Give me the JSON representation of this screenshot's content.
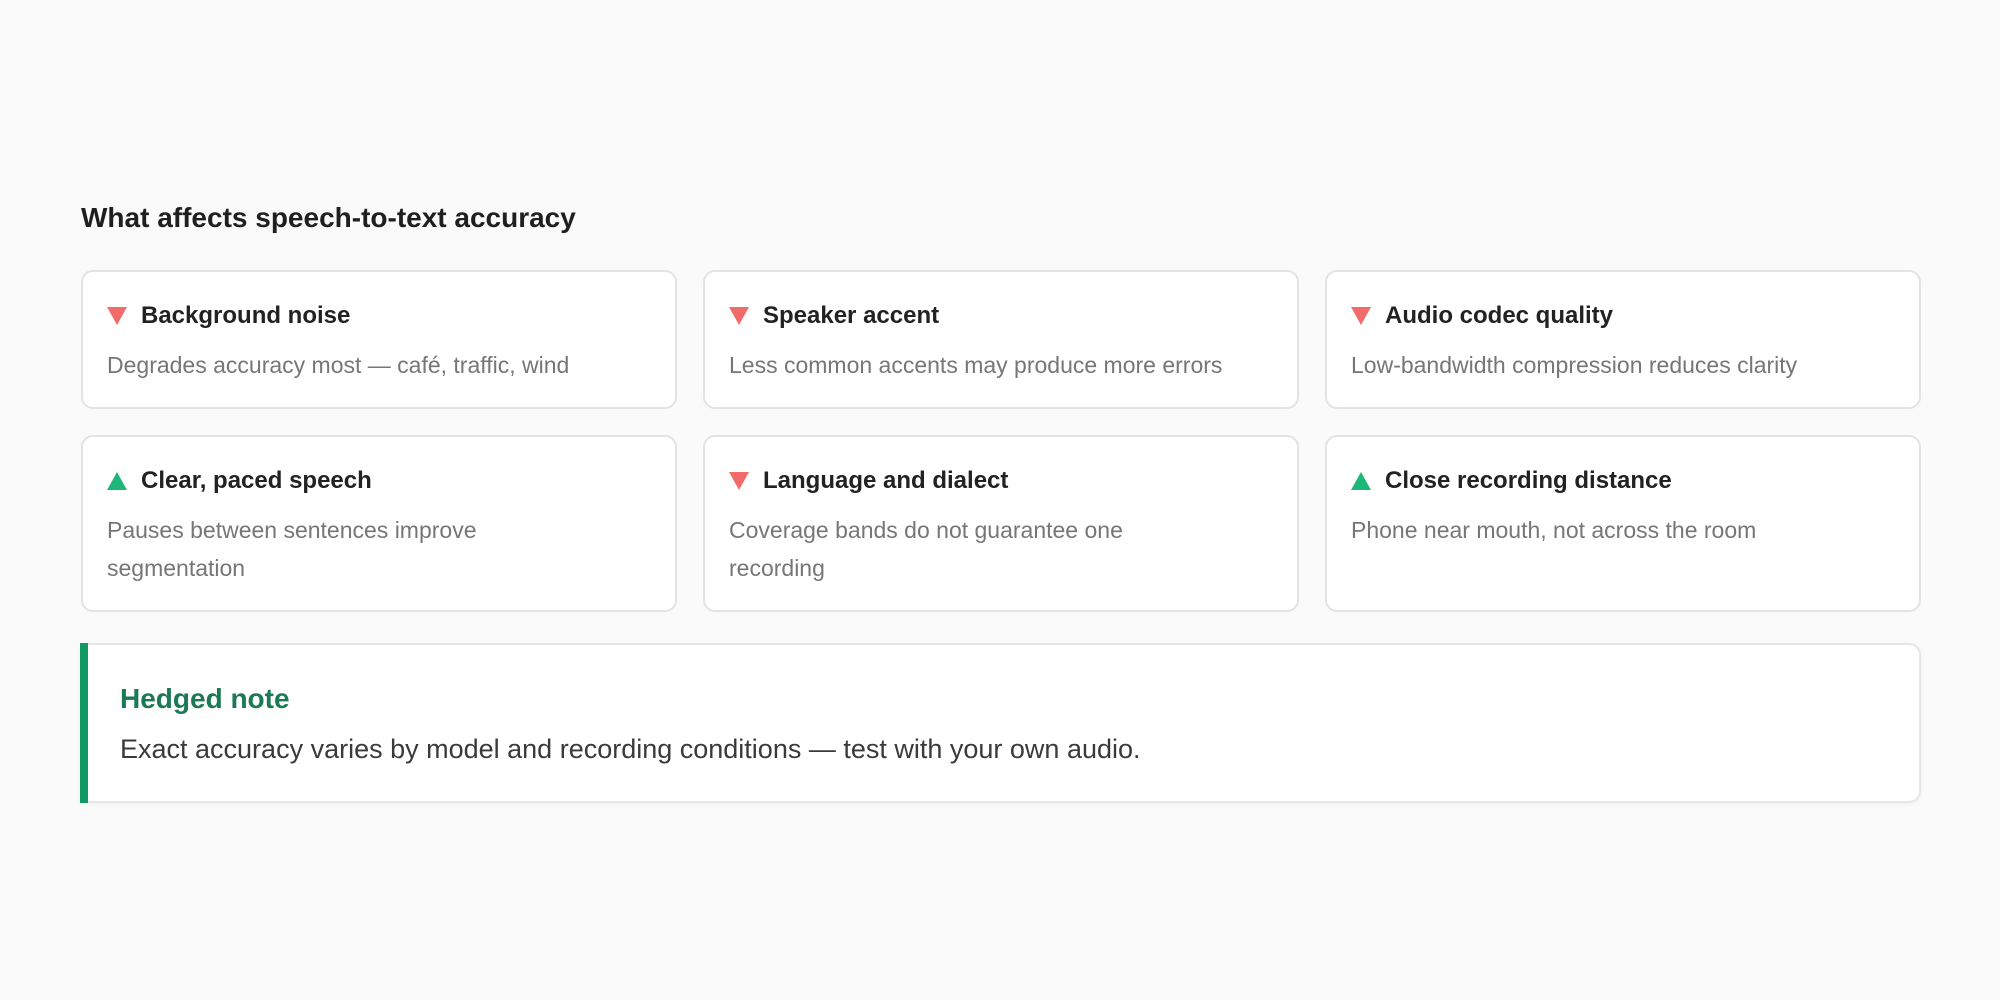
{
  "section_title": "What affects speech-to-text accuracy",
  "factors": [
    {
      "direction": "down",
      "icon": "down-triangle-icon",
      "title": "Background noise",
      "description": "Degrades accuracy most — café, traffic, wind"
    },
    {
      "direction": "down",
      "icon": "down-triangle-icon",
      "title": "Speaker accent",
      "description": "Less common accents may produce more errors"
    },
    {
      "direction": "down",
      "icon": "down-triangle-icon",
      "title": "Audio codec quality",
      "description": "Low-bandwidth compression reduces clarity"
    },
    {
      "direction": "up",
      "icon": "up-triangle-icon",
      "title": "Clear, paced speech",
      "description": "Pauses between sentences improve segmentation"
    },
    {
      "direction": "down",
      "icon": "down-triangle-icon",
      "title": "Language and dialect",
      "description": "Coverage bands do not guarantee one recording"
    },
    {
      "direction": "up",
      "icon": "up-triangle-icon",
      "title": "Close recording distance",
      "description": "Phone near mouth, not across the room"
    }
  ],
  "note": {
    "title": "Hedged note",
    "text": "Exact accuracy varies by model and recording conditions — test with your own audio."
  },
  "colors": {
    "negative": "#f26b6b",
    "positive": "#1fb67a",
    "note_accent": "#0f9a63",
    "note_title": "#1b7a53"
  }
}
